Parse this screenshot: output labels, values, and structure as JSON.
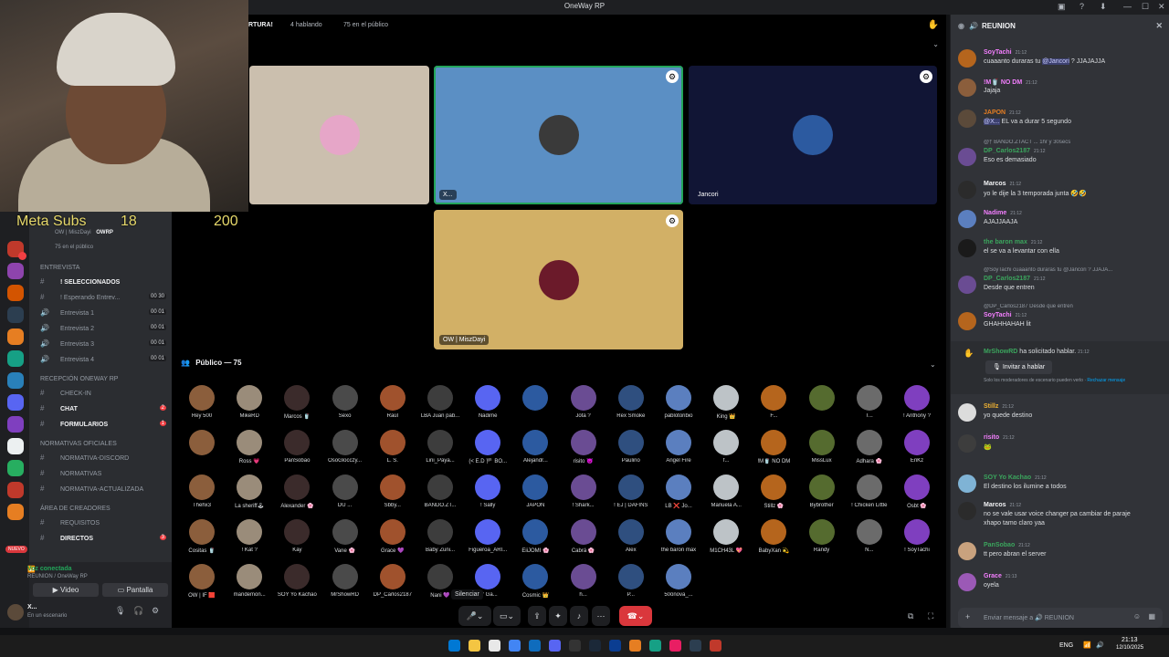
{
  "window": {
    "title": "OneWay RP"
  },
  "webcam_overlay": {
    "label": "Meta Subs",
    "count": "18",
    "goal": "200"
  },
  "stage": {
    "title_fragment": "RTURA!",
    "speaking": "4 hablando",
    "audience": "75 en el público",
    "speakers": [
      {
        "name": "",
        "bg": "#cbbfae",
        "avatar_color": "#e6a6c8"
      },
      {
        "name": "X...",
        "bg": "#5b8fc4",
        "avatar_color": "#3a3a3a"
      },
      {
        "name": "Jancori",
        "bg": "#111535",
        "avatar_color": "#2c5aa0"
      },
      {
        "name": "OW | MiszDayi",
        "bg": "#d2b066",
        "avatar_color": "#6b1a2a"
      }
    ],
    "public_header": "Público — 75",
    "tooltip": "Silenciar"
  },
  "audience": [
    "Rey 500",
    "MikeRD",
    "Marcos 🥤",
    "Sexo",
    "Raúl",
    "LBA Juan pab...",
    "Nadime",
    "",
    "Jota ?",
    "Rex Smoke",
    "pablotoribio",
    "King 👑",
    "F...",
    "",
    "T...",
    "! Anthony ?",
    "",
    "Ross 💗",
    "PanSobao",
    "OsoGlocczy...",
    "L. S.",
    "Lini_Paya...",
    "(< E.D 🏴 BO...",
    "Alejandr...",
    "risito 😈",
    "Paulino",
    "Angel Fire",
    "f...",
    "!M🥤 NO DM",
    "MissLux",
    "Adhara 🌸",
    "EriKz",
    "Thehx3",
    "La sheriff🕹",
    "Alexander 🌸",
    "DU ...",
    "Sbby...",
    "BANDO.ZT...",
    "! Sally",
    "JAPON",
    "! Shark...",
    "! EJ | DAFINS",
    "LB ❌ Jo...",
    "Manuela A...",
    "Stillz 🌸",
    "Bybrother",
    "! Chicken Little",
    "Ósbt 🌸",
    "Cositas 🥤",
    "! Kat ?",
    "Kay",
    "Vane 🌸",
    "Grace 💜",
    "Baby Zuni...",
    "Figueroa_ARI...",
    "EiiJOMI 🌸",
    "Cabrá 🌸",
    "Alex",
    "the baron max",
    "M1CH43L 💖",
    "BabyXan 💫",
    "Randy",
    "N...",
    "! SoyTachi",
    "OW | IF 🟥",
    "mandemon...",
    "SOY Yo Kachao",
    "MrShowRD",
    "DP_Carlos2187",
    "Nani 💜",
    "Cr Ga...",
    "Cosmic 👑",
    "h...",
    "P...",
    "50önova_...",
    "",
    "",
    "",
    "",
    ""
  ],
  "sidebar": {
    "presence": "OW | MiszDayi",
    "presence_tag": "OWRP",
    "public_count": "75 en el público",
    "categories": [
      {
        "name": "ENTREVISTA",
        "channels": [
          {
            "label": "! SELECCIONADOS",
            "bold": true,
            "num": ""
          },
          {
            "label": "! Esperando Entrev...",
            "bold": false,
            "num": "00 30"
          },
          {
            "label": "Entrevista 1",
            "bold": false,
            "num": "00 01"
          },
          {
            "label": "Entrevista 2",
            "bold": false,
            "num": "00 01"
          },
          {
            "label": "Entrevista 3",
            "bold": false,
            "num": "00 01"
          },
          {
            "label": "Entrevista 4",
            "bold": false,
            "num": "00 01"
          }
        ]
      },
      {
        "name": "Recepción OneWay RP",
        "channels": [
          {
            "label": "CHECK-IN",
            "bold": false,
            "num": ""
          },
          {
            "label": "CHAT",
            "bold": true,
            "num": "2"
          },
          {
            "label": "FORMULARIOS",
            "bold": true,
            "num": "1"
          }
        ]
      },
      {
        "name": "Normativas Oficiales",
        "channels": [
          {
            "label": "NORMATIVA-DISCORD",
            "bold": false,
            "num": ""
          },
          {
            "label": "NORMATIVAS",
            "bold": false,
            "num": ""
          },
          {
            "label": "NORMATIVA-ACTUALIZADA",
            "bold": false,
            "num": ""
          }
        ]
      },
      {
        "name": "Área de creadores",
        "channels": [
          {
            "label": "REQUISITOS",
            "bold": false,
            "num": ""
          },
          {
            "label": "DIRECTOS",
            "bold": true,
            "num": "3"
          }
        ]
      }
    ],
    "new_badge": "NUEVO",
    "voice": {
      "status": "Voz conectada",
      "where": "REUNION / OneWay RP",
      "video": "Video",
      "screen": "Pantalla"
    },
    "user": {
      "name": "X...",
      "status": "En un escenario"
    }
  },
  "chat": {
    "channel": "REUNION",
    "messages": [
      {
        "reply": "",
        "author": "SoyTachi",
        "time": "21:12",
        "text": "cuaaanto duraras tu",
        "mention": "@Jancori",
        "after": " ? JJAJAJJA",
        "color": "#f47fff",
        "av": "#b5651d"
      },
      {
        "reply": "",
        "author": "!M🥤 NO DM",
        "time": "21:12",
        "text": "Jajaja",
        "mention": "",
        "after": "",
        "color": "#f47fff",
        "av": "#8b5e3c"
      },
      {
        "reply": "",
        "author": "JAPON",
        "time": "21:12",
        "text": "",
        "mention": "@X...",
        "after": " EL va a durar 5 segundo",
        "color": "#e67e22",
        "av": "#5b4a3a"
      },
      {
        "reply": "@† BANDO.ZTACT ... 1hr y 30secs",
        "author": "DP_Carlos2187",
        "time": "21:12",
        "text": "Eso es demasiado",
        "mention": "",
        "after": "",
        "color": "#3ba55d",
        "av": "#6a4c93"
      },
      {
        "reply": "",
        "author": "Marcos",
        "time": "21:12",
        "text": "yo le dije la 3 temporada junta 🤣🤣",
        "mention": "",
        "after": "",
        "color": "#f2f3f5",
        "av": "#2b2b2b"
      },
      {
        "reply": "",
        "author": "Nadime",
        "time": "21:12",
        "text": "AJAJJAAJA",
        "mention": "",
        "after": "",
        "color": "#f47fff",
        "av": "#5b7fbf"
      },
      {
        "reply": "",
        "author": "the baron max",
        "time": "21:12",
        "text": "el se va a levantar con ella",
        "mention": "",
        "after": "",
        "color": "#3ba55d",
        "av": "#1a1a1a"
      },
      {
        "reply": "@SoyTachi cuaaanto duraras tu @Jancori ? JJAJA...",
        "author": "DP_Carlos2187",
        "time": "21:12",
        "text": "Desde que entren",
        "mention": "",
        "after": "",
        "color": "#3ba55d",
        "av": "#6a4c93"
      },
      {
        "reply": "@DP_Carlos2187 Desde que entren",
        "author": "SoyTachi",
        "time": "21:12",
        "text": "GHAHHAHAH lit",
        "mention": "",
        "after": "",
        "color": "#f47fff",
        "av": "#b5651d"
      }
    ],
    "request": {
      "who": "MrShowRD",
      "action": "ha solicitado hablar.",
      "time": "21:12",
      "button": "Invitar a hablar",
      "note": "Solo los moderadores de escenario pueden verlo ·",
      "dismiss": "Rechazar mensaje"
    },
    "messages2": [
      {
        "author": "Stillz",
        "time": "21:12",
        "text": "yo quede destino",
        "color": "#f0b232",
        "av": "#dcdcdc"
      },
      {
        "author": "risito",
        "time": "21:12",
        "text": "🐸",
        "color": "#f47fff",
        "av": "#3d3d3d"
      },
      {
        "author": "SOY Yo Kachao",
        "time": "21:12",
        "text": "El destino los ilumine a todos",
        "color": "#3ba55d",
        "av": "#7fb3d5"
      },
      {
        "author": "Marcos",
        "time": "21:12",
        "text": "no se vale usar voice changer pa cambiar de paraje",
        "text2": "xhapo tamo claro yaa",
        "color": "#f2f3f5",
        "av": "#2b2b2b"
      },
      {
        "author": "PanSobao",
        "time": "21:12",
        "text": "tt pero abran el server",
        "color": "#3ba55d",
        "av": "#c9a27e"
      },
      {
        "author": "Grace",
        "time": "21:13",
        "text": "oyela",
        "color": "#f47fff",
        "av": "#9b59b6"
      }
    ],
    "input_placeholder": "Enviar mensaje a 🔊 REUNION"
  },
  "taskbar": {
    "lang": "ENG",
    "time": "21:13",
    "date": "12/10/2025"
  },
  "colors": {
    "accent": "#5865f2",
    "danger": "#da373c",
    "online": "#23a55a"
  }
}
